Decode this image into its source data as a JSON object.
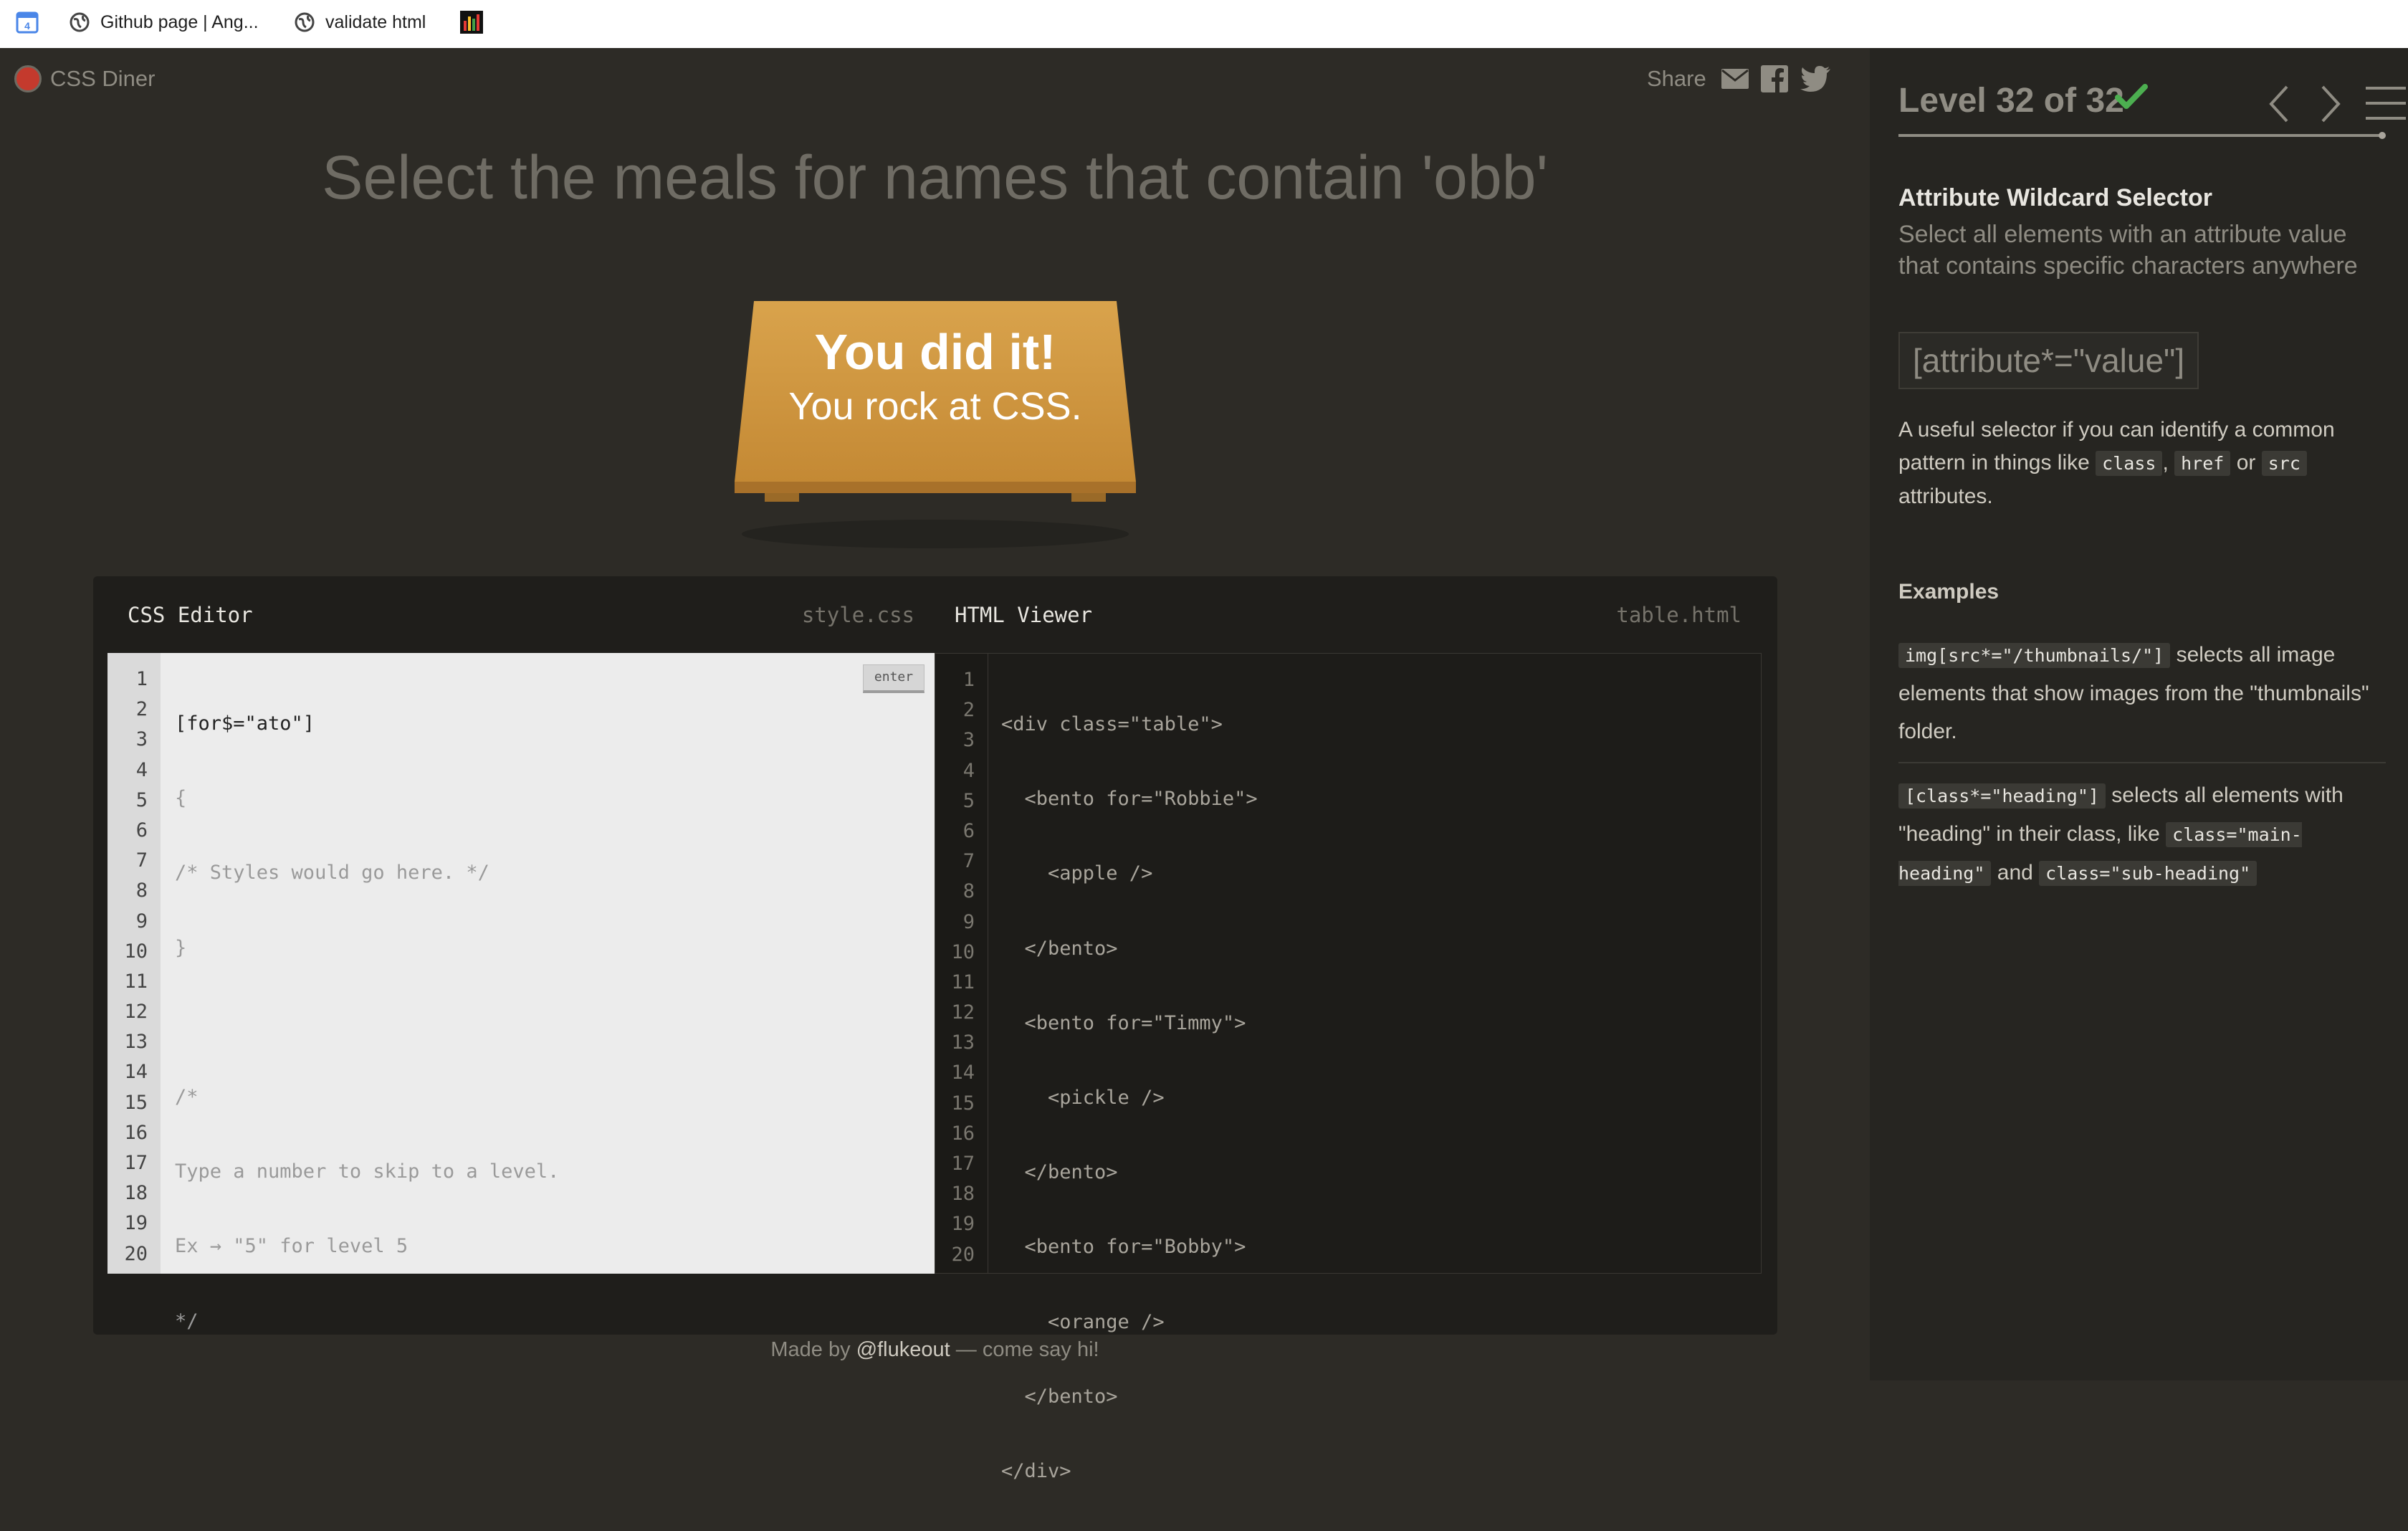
{
  "bookmarks": [
    {
      "label": "",
      "icon": "calendar-icon"
    },
    {
      "label": "Github page | Ang...",
      "icon": "globe-icon"
    },
    {
      "label": "validate html",
      "icon": "globe-icon"
    },
    {
      "label": "",
      "icon": "bar-chart-icon"
    }
  ],
  "game": {
    "logo_text": "CSS Diner",
    "share_label": "Share",
    "order": "Select the meals for names that contain 'obb'",
    "table_message_line1": "You did it!",
    "table_message_line2": "You rock at CSS.",
    "footer_prefix": "Made by",
    "footer_link": "@flukeout",
    "footer_suffix": "— come say hi!"
  },
  "editor": {
    "css_title": "CSS Editor",
    "css_file": "style.css",
    "html_title": "HTML Viewer",
    "html_file": "table.html",
    "enter_label": "enter",
    "line_numbers": [
      "1",
      "2",
      "3",
      "4",
      "5",
      "6",
      "7",
      "8",
      "9",
      "10",
      "11",
      "12",
      "13",
      "14",
      "15",
      "16",
      "17",
      "18",
      "19",
      "20"
    ],
    "css_input": "[for$=\"ato\"]",
    "css_lines": [
      "{",
      "/* Styles would go here. */",
      "}",
      "",
      "/*",
      "Type a number to skip to a level.",
      "Ex → \"5\" for level 5",
      "*/"
    ],
    "html_lines": [
      "<div class=\"table\">",
      "  <bento for=\"Robbie\">",
      "    <apple />",
      "  </bento>",
      "  <bento for=\"Timmy\">",
      "    <pickle />",
      "  </bento>",
      "  <bento for=\"Bobby\">",
      "    <orange />",
      "  </bento>",
      "</div>"
    ]
  },
  "sidebar": {
    "level_title": "Level 32 of 32",
    "progress": 1.0,
    "selector_name": "Attribute Wildcard Selector",
    "selector_title": "Select all elements with an attribute value that contains specific characters anywhere",
    "syntax": "[attribute*=\"value\"]",
    "hint_prefix": "A useful selector if you can identify a common pattern in things like",
    "hint_tag1": "class",
    "hint_sep": ",",
    "hint_tag2": "href",
    "hint_or": "or",
    "hint_tag3": "src",
    "hint_suffix": "attributes.",
    "examples_heading": "Examples",
    "example1_code": "img[src*=\"/thumbnails/\"]",
    "example1_text": "selects all image elements that show images from the \"thumbnails\" folder.",
    "example2_code": "[class*=\"heading\"]",
    "example2_text_a": "selects all elements with \"heading\" in their class, like",
    "example2_code2": "class=\"main-heading\"",
    "example2_and": "and",
    "example2_code3": "class=\"sub-heading\""
  },
  "colors": {
    "background": "#2d2b26",
    "sidebar": "#262521",
    "table": "#c98f3a",
    "check": "#4caf50",
    "logo_dot": "#c43a2d"
  }
}
